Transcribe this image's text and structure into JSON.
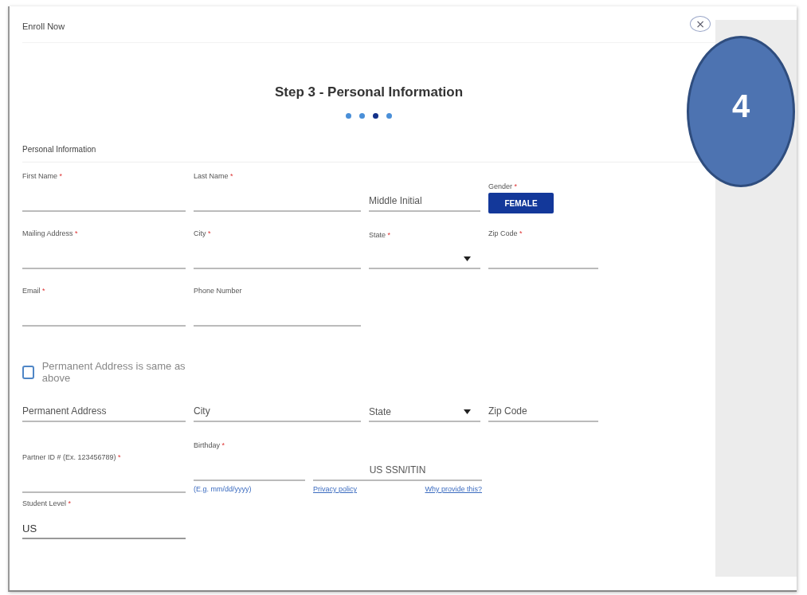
{
  "dialog": {
    "title": "Enroll Now",
    "close": "×"
  },
  "heading": "Step 3 - Personal Information",
  "steps": [
    {
      "selected": false
    },
    {
      "selected": false
    },
    {
      "selected": true
    },
    {
      "selected": false
    }
  ],
  "section_title": "Personal Information",
  "rows": [
    [
      {
        "kind": "text",
        "label": "First Name",
        "required_mark": "*"
      },
      {
        "kind": "text",
        "label": "Last Name",
        "required_mark": "*"
      },
      {
        "kind": "text",
        "placeholder": "Middle Initial"
      },
      {
        "kind": "toggle",
        "label": "Gender",
        "required_mark": "*",
        "options": [
          {
            "label": "FEMALE",
            "selected": true
          }
        ]
      }
    ],
    [
      {
        "kind": "text",
        "label": "Mailing Address",
        "required_mark": "*"
      },
      {
        "kind": "text",
        "label": "City",
        "required_mark": "*"
      },
      {
        "kind": "select",
        "label": "State",
        "required_mark": "*"
      },
      {
        "kind": "text",
        "label": "Zip Code",
        "required_mark": "*"
      }
    ],
    [
      {
        "kind": "text",
        "label": "Email",
        "required_mark": "*"
      },
      {
        "kind": "text",
        "label": "Phone Number"
      }
    ],
    [
      {
        "kind": "checkbox",
        "label": "Permanent Address is same as above",
        "checked": false
      }
    ],
    [
      {
        "kind": "text",
        "placeholder": "Permanent Address"
      },
      {
        "kind": "text",
        "placeholder": "City"
      },
      {
        "kind": "select",
        "placeholder": "State"
      },
      {
        "kind": "text",
        "placeholder": "Zip Code"
      }
    ],
    [
      {
        "kind": "text",
        "label": "Partner ID # (Ex. 123456789)",
        "required_mark": "*"
      },
      {
        "kind": "text",
        "label": "Birthday",
        "required_mark": "*",
        "hint": "(E.g. mm/dd/yyyy)"
      },
      {
        "kind": "text",
        "placeholder": "US SSN/ITIN",
        "links": [
          "Privacy policy",
          "Why provide this?"
        ]
      }
    ],
    [
      {
        "kind": "text",
        "label": "Student Level",
        "required_mark": "*",
        "value": "US"
      }
    ]
  ],
  "annotation": {
    "label": "4"
  }
}
